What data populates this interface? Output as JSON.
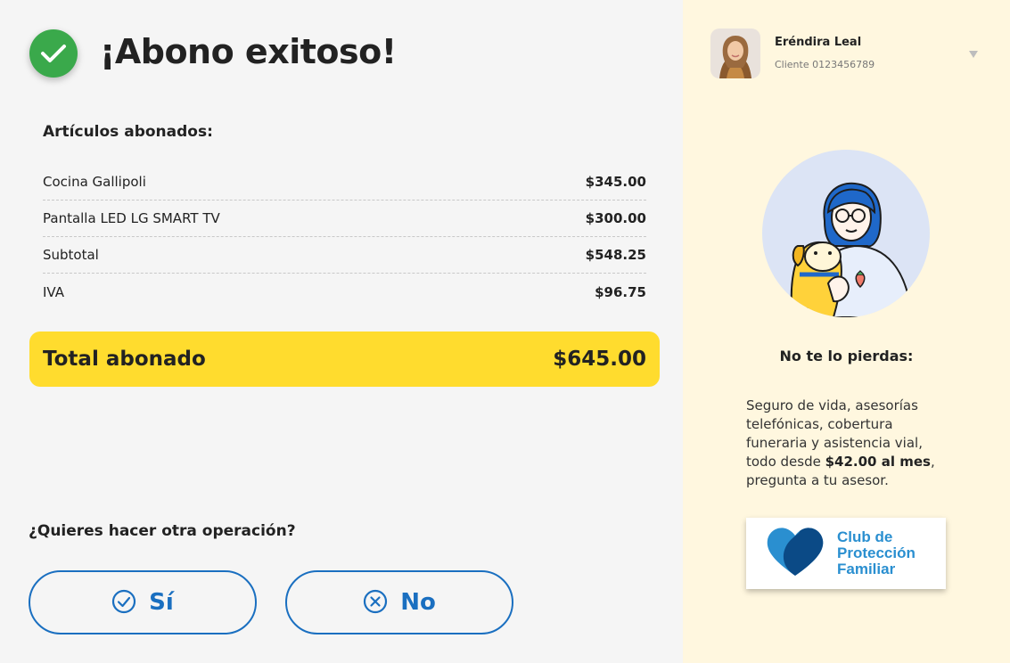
{
  "header": {
    "title": "¡Abono exitoso!"
  },
  "items": {
    "heading": "Artículos abonados:",
    "rows": [
      {
        "label": "Cocina Gallipoli",
        "amount": "$345.00"
      },
      {
        "label": "Pantalla LED LG SMART TV",
        "amount": "$300.00"
      },
      {
        "label": "Subtotal",
        "amount": "$548.25"
      },
      {
        "label": "IVA",
        "amount": "$96.75"
      }
    ]
  },
  "total": {
    "label": "Total abonado",
    "amount": "$645.00"
  },
  "operation": {
    "question": "¿Quieres hacer otra operación?",
    "yes_label": "Sí",
    "no_label": "No"
  },
  "user": {
    "name": "Eréndira Leal",
    "client_id": "Cliente 0123456789"
  },
  "promo": {
    "heading": "No te lo pierdas:",
    "text_before": "Seguro de vida, asesorías telefónicas, cobertura funeraria y asistencia vial, todo desde ",
    "price": "$42.00 al mes",
    "text_after": ", pregunta a tu asesor.",
    "club_line1": "Club de",
    "club_line2": "Protección",
    "club_line3": "Familiar"
  },
  "colors": {
    "success": "#3aa94b",
    "accent_yellow": "#ffdc2e",
    "primary_blue": "#1a6fc0",
    "side_background": "#fff7df",
    "club_blue": "#2a8fd0"
  },
  "icons": {
    "success": "check-icon",
    "yes": "check-circle-icon",
    "no": "x-circle-icon",
    "dropdown": "chevron-down-icon",
    "club": "heart-icon"
  }
}
